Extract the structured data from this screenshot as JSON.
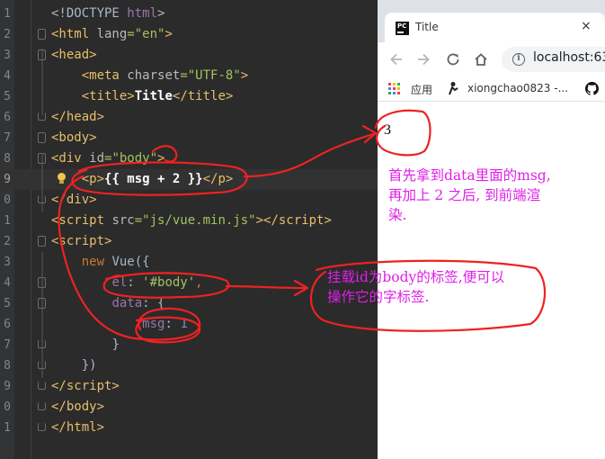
{
  "editor": {
    "lines": [
      {
        "num": "1",
        "html": "<span>&lt;!DOCTYPE </span><span class=\"i\">html</span><span>&gt;</span>"
      },
      {
        "num": "2",
        "html": "<span class=\"t\">&lt;html </span><span class=\"a\">lang</span><span class=\"s\">=\"en\"</span><span class=\"t\">&gt;</span>"
      },
      {
        "num": "3",
        "html": "<span class=\"t\">&lt;head&gt;</span>"
      },
      {
        "num": "4",
        "html": "    <span class=\"t\">&lt;meta </span><span class=\"a\">charset</span><span class=\"s\">=\"UTF-8\"</span><span class=\"t\">&gt;</span>"
      },
      {
        "num": "5",
        "html": "    <span class=\"t\">&lt;title&gt;</span><span class=\"w\">Title</span><span class=\"t\">&lt;/title&gt;</span>"
      },
      {
        "num": "6",
        "html": "<span class=\"t\">&lt;/head&gt;</span>"
      },
      {
        "num": "7",
        "html": "<span class=\"t\">&lt;body&gt;</span>"
      },
      {
        "num": "8",
        "html": "<span class=\"t\">&lt;div </span><span class=\"a\">id</span><span class=\"s\">=\"body\"</span><span class=\"t\">&gt;</span>"
      },
      {
        "num": "9",
        "html": "    <span class=\"t\">&lt;p&gt;</span><span class=\"w\">{{ msg + 2 }}</span><span class=\"t\">&lt;/p&gt;</span>"
      },
      {
        "num": "0",
        "html": "<span class=\"t\">&lt;/div&gt;</span>"
      },
      {
        "num": "1",
        "html": "<span class=\"t\">&lt;script </span><span class=\"a\">src</span><span class=\"s\">=\"js/vue.min.js\"</span><span class=\"t\">&gt;&lt;/script&gt;</span>"
      },
      {
        "num": "2",
        "html": "<span class=\"t\">&lt;script&gt;</span>"
      },
      {
        "num": "3",
        "html": "    <span class=\"k\">new </span><span>Vue({</span>"
      },
      {
        "num": "4",
        "html": "        <span class=\"i\">el</span><span>: </span><span class=\"s\">'#body'</span><span class=\"k\">,</span>"
      },
      {
        "num": "5",
        "html": "        <span class=\"i\">data</span><span>: {</span>"
      },
      {
        "num": "6",
        "html": "            <span class=\"i\">msg</span><span>: </span><span class=\"n\">1</span>"
      },
      {
        "num": "7",
        "html": "        <span>}</span>"
      },
      {
        "num": "8",
        "html": "    <span>})</span>"
      },
      {
        "num": "9",
        "html": "<span class=\"t\">&lt;/script&gt;</span>"
      },
      {
        "num": "0",
        "html": "<span class=\"t\">&lt;/body&gt;</span>"
      },
      {
        "num": "1",
        "html": "<span class=\"t\">&lt;/html&gt;</span>"
      }
    ]
  },
  "browser": {
    "tab_title": "Title",
    "tab_icon_text": "PC",
    "tab_close": "×",
    "url": "localhost:63",
    "bookmarks": {
      "apps_label": "应用",
      "user_label": "xiongchao0823 -..."
    },
    "page_output": "3"
  },
  "annotations": {
    "note1": "首先拿到data里面的msg,\n再加上 2 之后, 到前端渲\n染.",
    "note2": "挂载id为body的标签,便可以\n操作它的字标签."
  },
  "colors": {
    "annotation_red": "#ee2222",
    "annotation_text": "#e01ee8",
    "editor_bg": "#2b2b2b"
  }
}
